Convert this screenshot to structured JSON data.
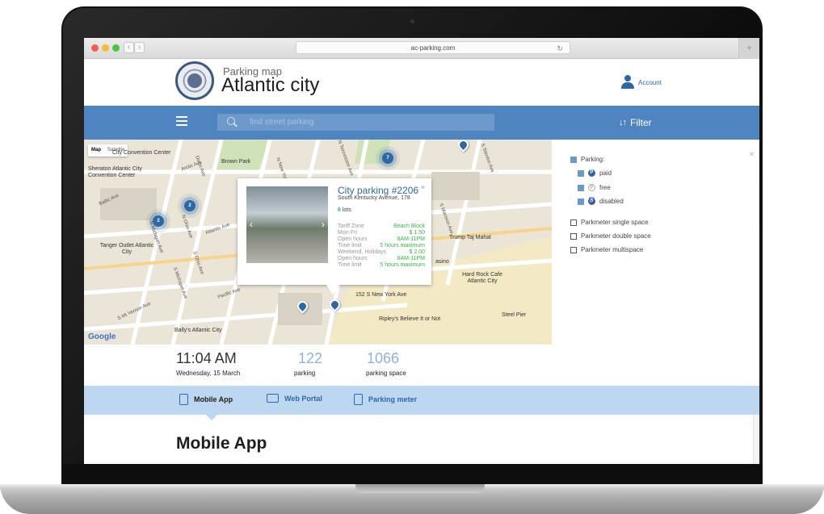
{
  "browser": {
    "url": "ac-parking.com",
    "back_label": "‹",
    "forward_label": "›",
    "reload_icon": "reload-icon",
    "newtab_label": "+"
  },
  "header": {
    "subtitle": "Parking map",
    "title": "Atlantic city",
    "account_label": "Account"
  },
  "navbar": {
    "search_placeholder": "find street parking",
    "filter_label": "Filter"
  },
  "map": {
    "type_map": "Map",
    "type_satellite": "Satellite",
    "google_label": "Google",
    "places": [
      "City Convention Center",
      "Sheraton Atlantic City Convention Center",
      "Brown Park",
      "Tanger Outlet Atlantic City",
      "Trump Taj Mahal",
      "Hard Rock Cafe Atlantic City",
      "152 S New York Ave",
      "Ripley's Believe It or Not",
      "Steel Pier",
      "Bally's Atlantic City",
      "asino"
    ],
    "streets": [
      "Baltic Ave",
      "N Ohio Ave",
      "N Michigan Ave",
      "Atlantic Ave",
      "S Ohio Ave",
      "S Michigan Ave",
      "Pacific Ave",
      "N Tennessee Ave",
      "S Mansion Ave",
      "S Mt Vernon Ave",
      "Dixon Ave",
      "N New York Ave",
      "Arctic Ave",
      "S Stenton Ave"
    ],
    "clusters": [
      "2",
      "2",
      "7"
    ]
  },
  "popup": {
    "title": "City parking #2206",
    "address": "South Kentucky Avenue, 178",
    "lots_count": "6",
    "lots_label": "lots",
    "rows": [
      {
        "k": "Tariff Zone",
        "v": "Beach Block"
      },
      {
        "k": "Mon-Fri",
        "v": "$ 1.50"
      },
      {
        "k": "Open hours",
        "v": "8AM-11PM"
      },
      {
        "k": "Time limit",
        "v": "5 hours maximum"
      },
      {
        "k": "Weekend, Holidays",
        "v": "$ 2.00"
      },
      {
        "k": "Open hours",
        "v": "8AM-11PM"
      },
      {
        "k": "Time limit",
        "v": "5 hours maximum"
      }
    ],
    "close_label": "×"
  },
  "filters": {
    "parking_label": "Parking:",
    "paid_label": "paid",
    "free_label": "free",
    "disabled_label": "disabled",
    "single_label": "Parkmeter single space",
    "double_label": "Parkmeter double space",
    "multi_label": "Parkmeter multispace",
    "close_label": "×"
  },
  "stats": {
    "time": "11:04 AM",
    "date": "Wednesday, 15 March",
    "parking_count": "122",
    "parking_label": "parking",
    "space_count": "1066",
    "space_label": "parking space"
  },
  "tabs": [
    {
      "label": "Mobile App"
    },
    {
      "label": "Web Portal"
    },
    {
      "label": "Parking meter"
    }
  ],
  "section": {
    "title": "Mobile App"
  },
  "colors": {
    "brand_blue": "#4e84c0",
    "link_blue": "#2d67a6",
    "tab_bg": "#bdd7f0",
    "green": "#3bb34a"
  }
}
